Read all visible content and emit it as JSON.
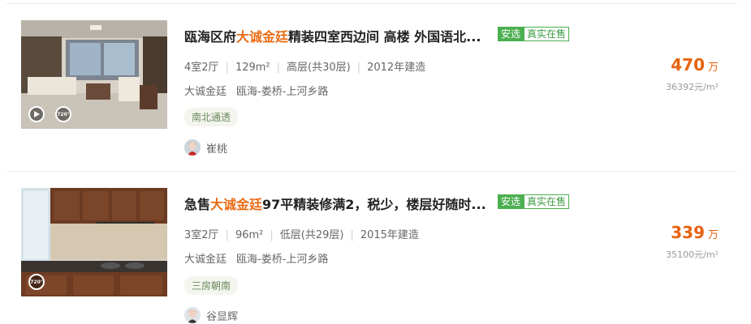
{
  "listings": [
    {
      "title_pre": "瓯海区府",
      "title_hl": "大诚金廷",
      "title_post": "精装四室西边间 高楼 外国语北...",
      "tag_a": "安选",
      "tag_b": "真实在售",
      "rooms": "4室2厅",
      "size": "129m²",
      "floor": "高层(共30层)",
      "built": "2012年建造",
      "community": "大诚金廷",
      "area": "瓯海-娄桥-上河乡路",
      "feature": "南北通透",
      "agent": "崔桃",
      "price": "470",
      "price_unit": "万",
      "unit_price": "36392元/m²",
      "icons": [
        "play-icon",
        "panorama-720-icon"
      ]
    },
    {
      "title_pre": "急售",
      "title_hl": "大诚金廷",
      "title_post": "97平精装修满2，税少，楼层好随时...",
      "tag_a": "安选",
      "tag_b": "真实在售",
      "rooms": "3室2厅",
      "size": "96m²",
      "floor": "低层(共29层)",
      "built": "2015年建造",
      "community": "大诚金廷",
      "area": "瓯海-娄桥-上河乡路",
      "feature": "三房朝南",
      "agent": "谷显辉",
      "price": "339",
      "price_unit": "万",
      "unit_price": "35100元/m²",
      "icons": [
        "panorama-720-icon"
      ]
    }
  ],
  "colors": {
    "highlight": "#ea6b14",
    "price": "#e8620f",
    "tag_green": "#4caf50",
    "feature_bg": "#f3f5ee"
  }
}
